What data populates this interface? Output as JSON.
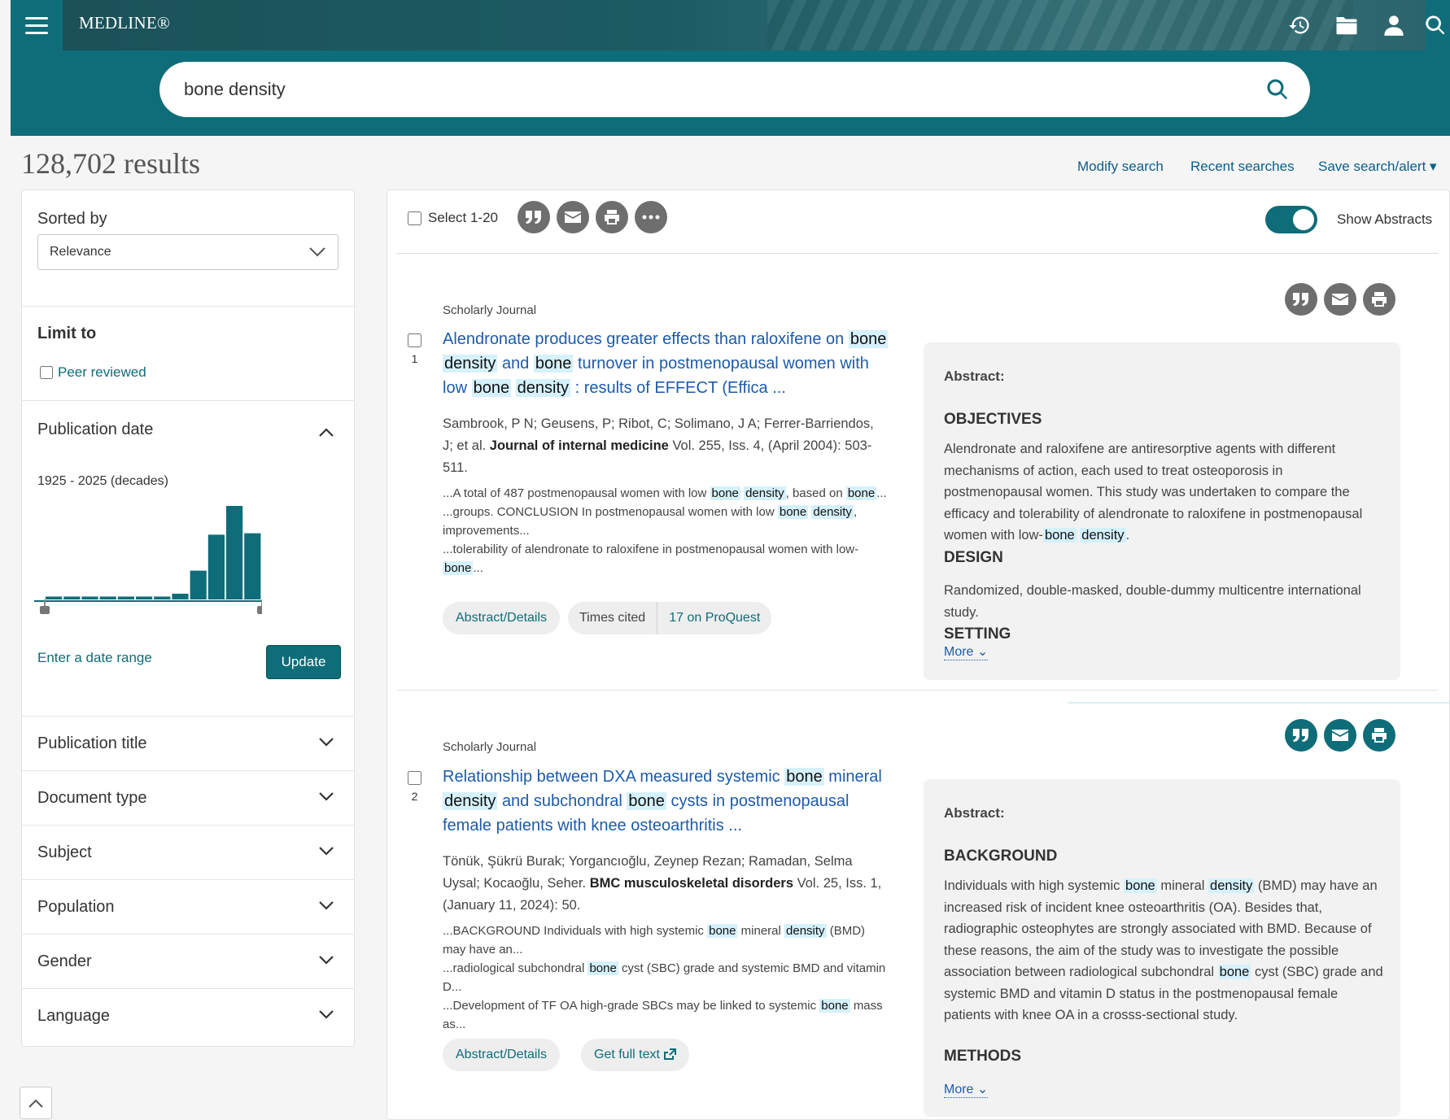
{
  "header": {
    "brand": "MEDLINE®",
    "search_value": "bone density",
    "icons": [
      "menu-icon",
      "history-icon",
      "folder-icon",
      "user-icon",
      "search-icon"
    ]
  },
  "results_header": {
    "count": "128,702 results",
    "modify": "Modify search",
    "recent": "Recent searches",
    "save": "Save search/alert ▾"
  },
  "sidebar": {
    "sorted_by": "Sorted by",
    "sort_value": "Relevance",
    "limit_to": "Limit to",
    "peer_reviewed": "Peer reviewed",
    "publication_date": "Publication date",
    "date_range": "1925 - 2025 (decades)",
    "histogram": [
      2,
      2,
      2,
      2,
      2,
      2,
      2,
      4,
      20,
      45,
      65,
      46
    ],
    "enter_range": "Enter a date range",
    "update": "Update",
    "facets": [
      "Publication title",
      "Document type",
      "Subject",
      "Population",
      "Gender",
      "Language"
    ]
  },
  "toolbar": {
    "select": "Select 1-20",
    "show_abstracts": "Show Abstracts"
  },
  "results": [
    {
      "number": "1",
      "source_type": "Scholarly Journal",
      "authors_pre": "Sambrook, P N; Geusens, P; Ribot, C; Solimano, J A; Ferrer-Barriendos, J; et al.",
      "journal": "Journal of internal medicine",
      "citation": "Vol. 255, Iss. 4, (April 2004): 503-511.",
      "btn1": "Abstract/Details",
      "cited_label": "Times cited",
      "cited_value": "17 on ProQuest",
      "abstract_label": "Abstract:",
      "h1": "OBJECTIVES",
      "p1_pre": "Alendronate and raloxifene are antiresorptive agents with different mechanisms of action, each used to treat osteoporosis in postmenopausal women. This study was undertaken to compare the efficacy and tolerability of alendronate to raloxifene in postmenopausal women with low-",
      "h2": "DESIGN",
      "p2": "Randomized, double-masked, double-dummy multicentre international study.",
      "h3": "SETTING",
      "more": "More"
    },
    {
      "number": "2",
      "source_type": "Scholarly Journal",
      "authors_pre": "Tönük, Şükrü Burak; Yorgancıoğlu, Zeynep Rezan; Ramadan, Selma Uysal; Kocaoğlu, Seher.",
      "journal": "BMC musculoskeletal disorders",
      "citation": "Vol. 25, Iss. 1,  (January 11, 2024): 50.",
      "btn1": "Abstract/Details",
      "fulltext": "Get full text",
      "abstract_label": "Abstract:",
      "h1": "BACKGROUND",
      "h2": "METHODS",
      "more": "More"
    }
  ],
  "hl": {
    "bone": "bone",
    "density": "density"
  },
  "text": {
    "r1_title_a": "Alendronate produces greater effects than raloxifene on",
    "r1_title_and": "and",
    "r1_title_b": "turnover in postmenopausal women with low",
    "r1_title_c": ": results of EFFECT (Effica ...",
    "r1_s1a": "...A total of 487 postmenopausal women with low",
    "r1_s1b": ", based on",
    "r1_s1c": "...",
    "r1_s2a": "...groups. CONCLUSION In postmenopausal women with low",
    "r1_s2b": ", improvements...",
    "r1_s3a": "...tolerability of alendronate to raloxifene in postmenopausal women with low-",
    "r1_s3b": "...",
    "r1_p1_end": ".",
    "r2_title_a": "Relationship between DXA measured systemic",
    "r2_title_b": "mineral",
    "r2_title_c": "and subchondral",
    "r2_title_d": "cysts in postmenopausal female patients with knee osteoarthritis ...",
    "r2_s1a": "...BACKGROUND Individuals with high systemic",
    "r2_s1b": "mineral",
    "r2_s1c": "(BMD) may have an...",
    "r2_s2a": "...radiological subchondral",
    "r2_s2b": "cyst (SBC) grade and systemic BMD and vitamin D...",
    "r2_s3a": "...Development of TF OA high-grade SBCs may be linked to systemic",
    "r2_s3b": "mass as...",
    "r2_p1a": "Individuals with high systemic",
    "r2_p1b": "mineral",
    "r2_p1c": "(BMD) may have an increased risk of incident knee osteoarthritis (OA). Besides that, radiographic osteophytes are strongly associated with BMD. Because of these reasons, the aim of the study was to investigate the possible association between radiological subchondral",
    "r2_p1d": "cyst (SBC) grade and systemic BMD and vitamin D status in the postmenopausal female patients with knee OA in a crosss-sectional study."
  }
}
